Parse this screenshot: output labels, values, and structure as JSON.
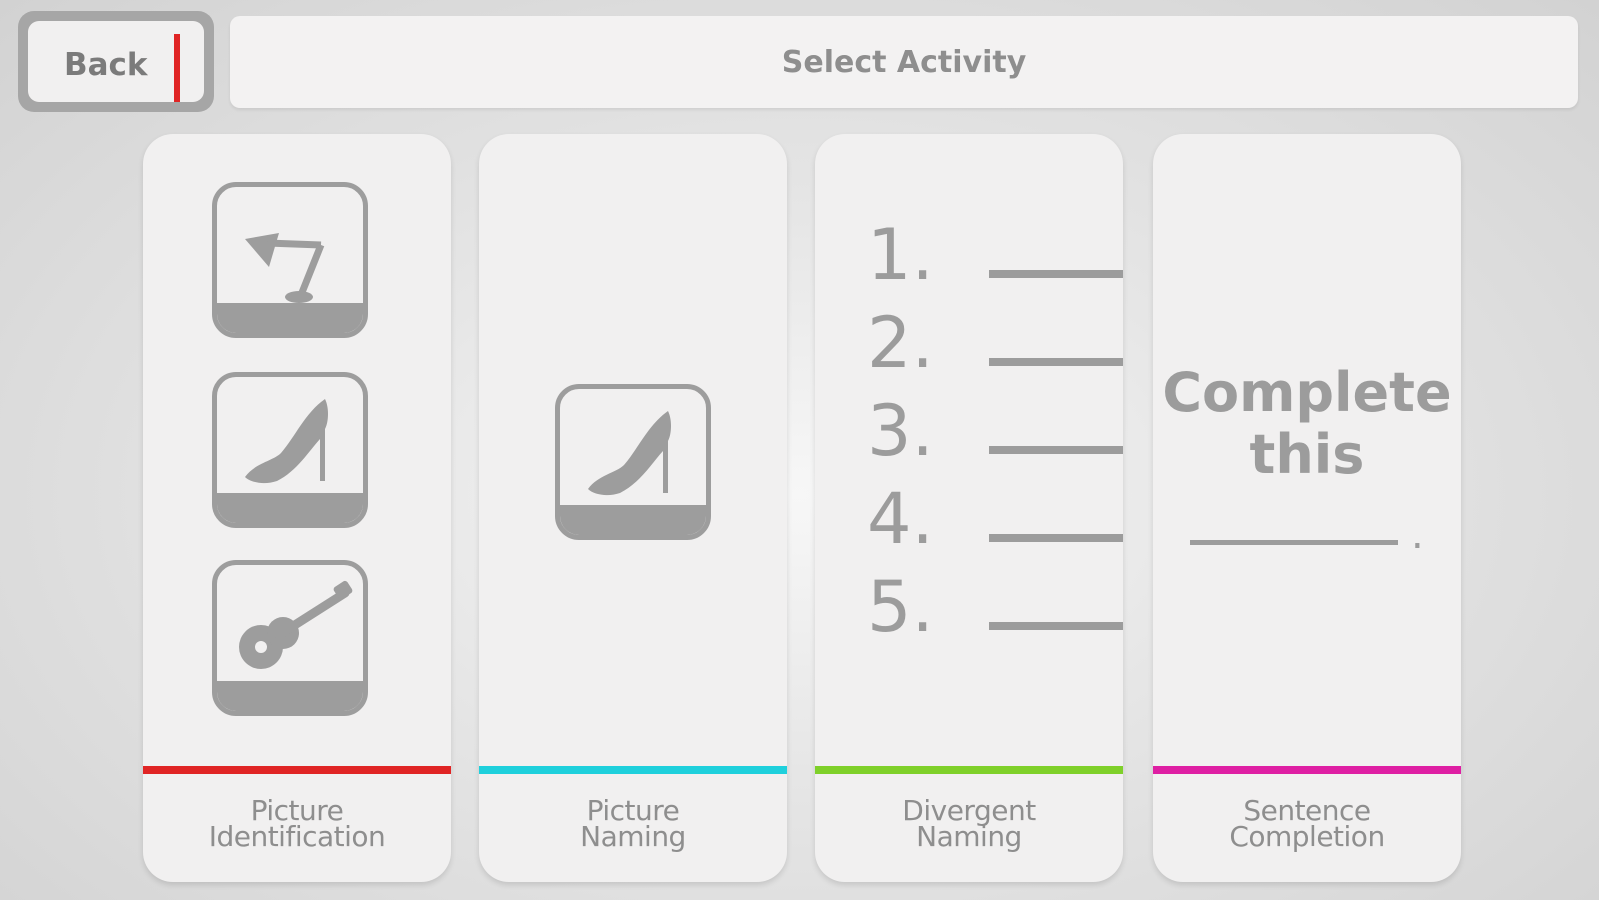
{
  "header": {
    "back_label": "Back",
    "title": "Select Activity"
  },
  "colors": {
    "back_accent": "#e02424",
    "picture_identification": "#e02424",
    "picture_naming": "#1fd0dc",
    "divergent_naming": "#7fd02a",
    "sentence_completion": "#de1fa3"
  },
  "activities": [
    {
      "label_line1": "Picture",
      "label_line2": "Identification",
      "icons": [
        "lamp-icon",
        "high-heel-shoe-icon",
        "guitar-icon"
      ]
    },
    {
      "label_line1": "Picture",
      "label_line2": "Naming",
      "icons": [
        "high-heel-shoe-icon"
      ]
    },
    {
      "label_line1": "Divergent",
      "label_line2": "Naming",
      "list_numbers": [
        "1.",
        "2.",
        "3.",
        "4.",
        "5."
      ]
    },
    {
      "label_line1": "Sentence",
      "label_line2": "Completion",
      "preview_line1": "Complete",
      "preview_line2": "this",
      "preview_end": "."
    }
  ]
}
